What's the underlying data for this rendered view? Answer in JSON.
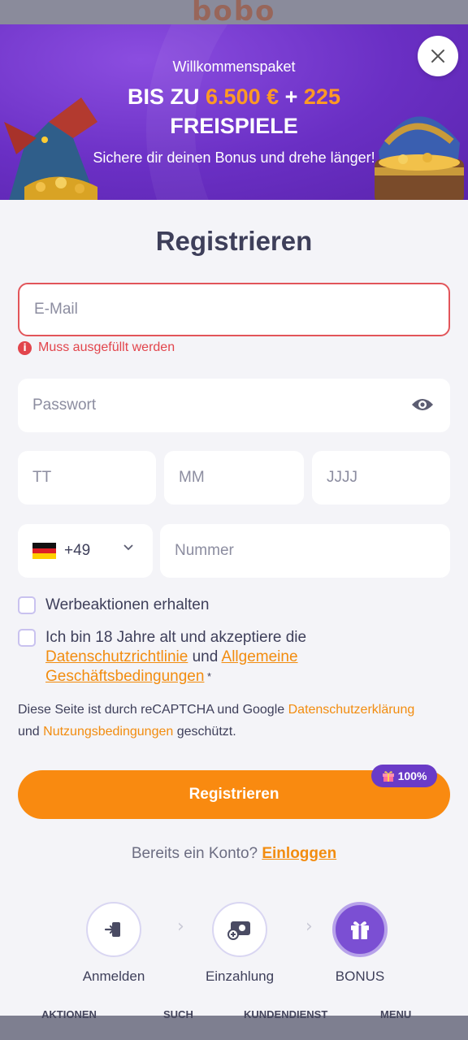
{
  "background": {
    "logo_text": "bobo",
    "nav": [
      "AKTIONEN",
      "SUCH",
      "KUNDENDIENST",
      "MENU"
    ]
  },
  "banner": {
    "kicker": "Willkommenspaket",
    "line1_prefix": "BIS ZU ",
    "line1_amount": "6.500 €",
    "line1_plus": " + ",
    "line1_spins": "225",
    "line2": "FREISPIELE",
    "subtitle": "Sichere dir deinen Bonus und drehe länger!"
  },
  "form": {
    "title": "Registrieren",
    "email_placeholder": "E-Mail",
    "email_error": "Muss ausgefüllt werden",
    "password_placeholder": "Passwort",
    "day_placeholder": "TT",
    "month_placeholder": "MM",
    "year_placeholder": "JJJJ",
    "country_code": "+49",
    "phone_placeholder": "Nummer",
    "promo_label": "Werbeaktionen erhalten",
    "terms_prefix": "Ich bin 18 Jahre alt und akzeptiere die",
    "privacy_link": "Datenschutzrichtlinie",
    "terms_and": " und ",
    "gtc_link_1": "Allgemeine",
    "gtc_link_2": "Geschäftsbedingungen",
    "terms_required_mark": " *",
    "recaptcha_text_1": "Diese Seite ist durch reCAPTCHA und Google ",
    "recaptcha_privacy_link": "Datenschutzerklärung",
    "recaptcha_text_2": "und ",
    "recaptcha_terms_link": "Nutzungsbedingungen",
    "recaptcha_text_3": " geschützt.",
    "submit_label": "Registrieren",
    "bonus_badge": "100%",
    "login_prompt": "Bereits ein Konto? ",
    "login_link": "Einloggen"
  },
  "steps": [
    {
      "label": "Anmelden",
      "icon": "login-icon",
      "active": false
    },
    {
      "label": "Einzahlung",
      "icon": "deposit-icon",
      "active": false
    },
    {
      "label": "BONUS",
      "icon": "gift-icon",
      "active": true
    }
  ],
  "colors": {
    "accent_orange": "#f98a10",
    "brand_purple": "#6a2fc4",
    "error_red": "#e2454c",
    "link_orange": "#f28c0f"
  }
}
